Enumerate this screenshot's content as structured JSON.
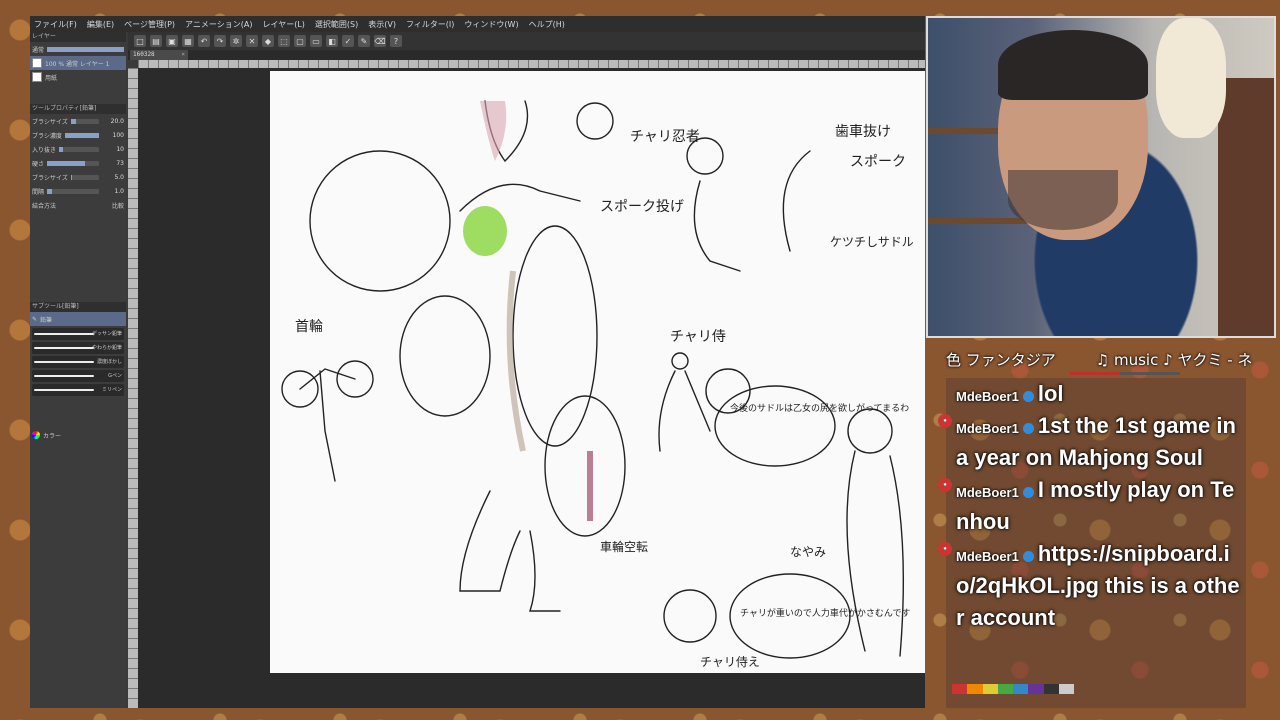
{
  "menu": [
    "ファイル(F)",
    "編集(E)",
    "ページ管理(P)",
    "アニメーション(A)",
    "レイヤー(L)",
    "選択範囲(S)",
    "表示(V)",
    "フィルター(I)",
    "ウィンドウ(W)",
    "ヘルプ(H)"
  ],
  "document_tab": "160328",
  "layers_panel": {
    "title": "レイヤー",
    "blend_mode": "通常",
    "layers": [
      {
        "name": "100 % 通常 レイヤー 1",
        "active": true
      },
      {
        "name": "用紙",
        "active": false
      }
    ]
  },
  "tool_properties": {
    "title": "ツールプロパティ[鉛筆]",
    "items": [
      {
        "label": "ブラシサイズ",
        "value": "20.0",
        "fill": 0.2
      },
      {
        "label": "ブラシ濃度",
        "value": "100",
        "fill": 1.0
      },
      {
        "label": "入り抜き",
        "value": "10",
        "fill": 0.1
      },
      {
        "label": "硬さ",
        "value": "73",
        "fill": 0.73
      },
      {
        "label": "ブラシサイズ",
        "value": "5.0",
        "fill": 0.05
      },
      {
        "label": "間隔",
        "value": "1.0",
        "fill": 0.1
      }
    ],
    "combine_label": "結合方法",
    "combine_value": "比較"
  },
  "subtool_panel": {
    "title": "サブツール[鉛筆]",
    "tab": "鉛筆",
    "brushes": [
      "デッサン鉛筆",
      "やわらか鉛筆",
      "濃度ぼかし",
      "Gペン",
      "ミリペン"
    ]
  },
  "color_panel": {
    "label": "カラー"
  },
  "stream": {
    "title": "色 ファンタジア",
    "music": "♫ music ♪ ヤクミ - ネ",
    "progress": 0.45
  },
  "chat": [
    {
      "user": "MdeBoer1",
      "text": "lol"
    },
    {
      "user": "MdeBoer1",
      "text": "1st the 1st game in a year on Mahjong Soul"
    },
    {
      "user": "MdeBoer1",
      "text": "I mostly play on Tenhou"
    },
    {
      "user": "MdeBoer1",
      "text": "https://snipboard.io/2qHkOL.jpg this is a other account"
    }
  ],
  "sketch_notes": [
    "チャリ忍者",
    "スポーク投げ",
    "首輪",
    "チャリ侍",
    "今後のサドルは乙女の尻を欲しがってまるわ",
    "車輪空転",
    "なやみ",
    "チャリが重いので人力車代がかさむんです",
    "チャリ侍え",
    "ケツチしサドル",
    "スポーク",
    "歯車抜け"
  ],
  "colors": {
    "accent": "#5a6a88",
    "progress": "#c0302a",
    "mod_badge": "#2f8de0"
  }
}
